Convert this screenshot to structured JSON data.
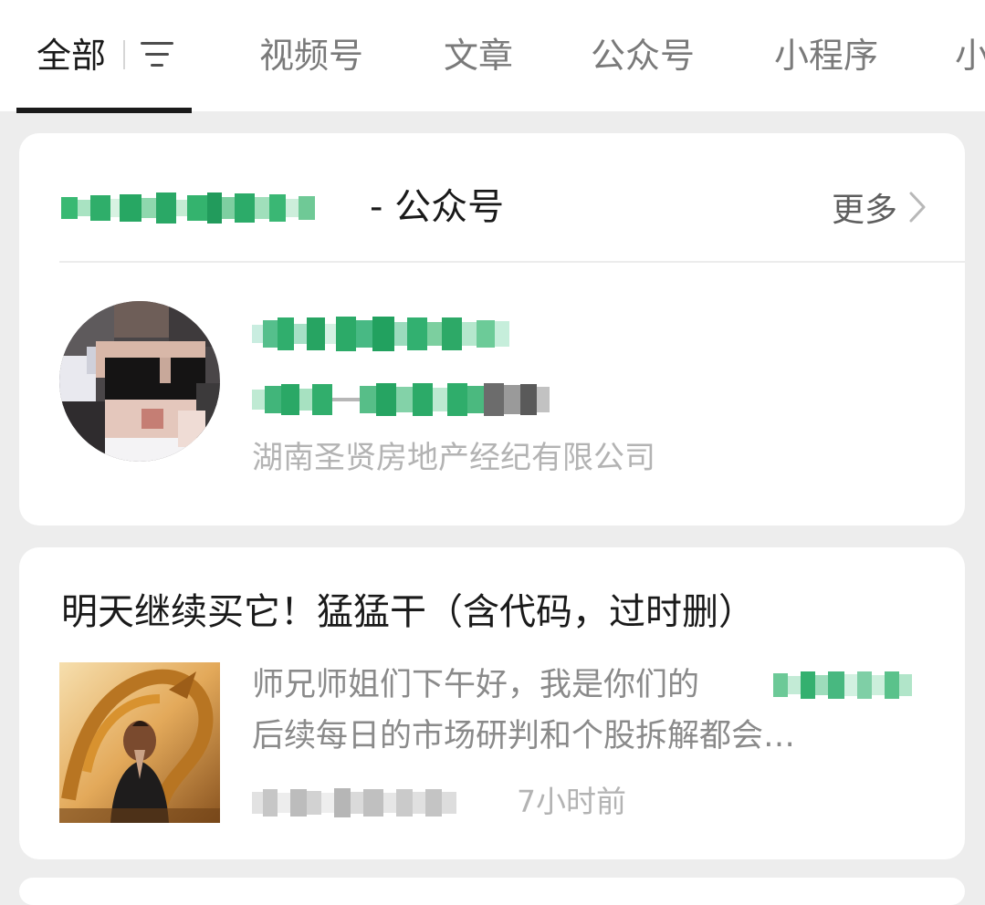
{
  "tabs": {
    "all": "全部",
    "video": "视频号",
    "article": "文章",
    "account": "公众号",
    "mini": "小程序",
    "cut": "小"
  },
  "icons": {
    "filter": "filter-icon",
    "more": "chevron-right-icon"
  },
  "colors": {
    "brand_green": "#2bb673",
    "text_primary": "#1a1a1a",
    "text_secondary": "#8a8a8a",
    "text_tertiary": "#b3b3b3",
    "page_bg": "#ededed"
  },
  "account_card": {
    "title_suffix": "- 公众号",
    "more_label": "更多",
    "company": "湖南圣贤房地产经纪有限公司"
  },
  "article_card": {
    "title": "明天继续买它！猛猛干（含代码，过时删）",
    "summary_line1": "师兄师姐们下午好，我是你们的",
    "summary_line2": "后续每日的市场研判和个股拆解都会…",
    "time": "7小时前"
  }
}
